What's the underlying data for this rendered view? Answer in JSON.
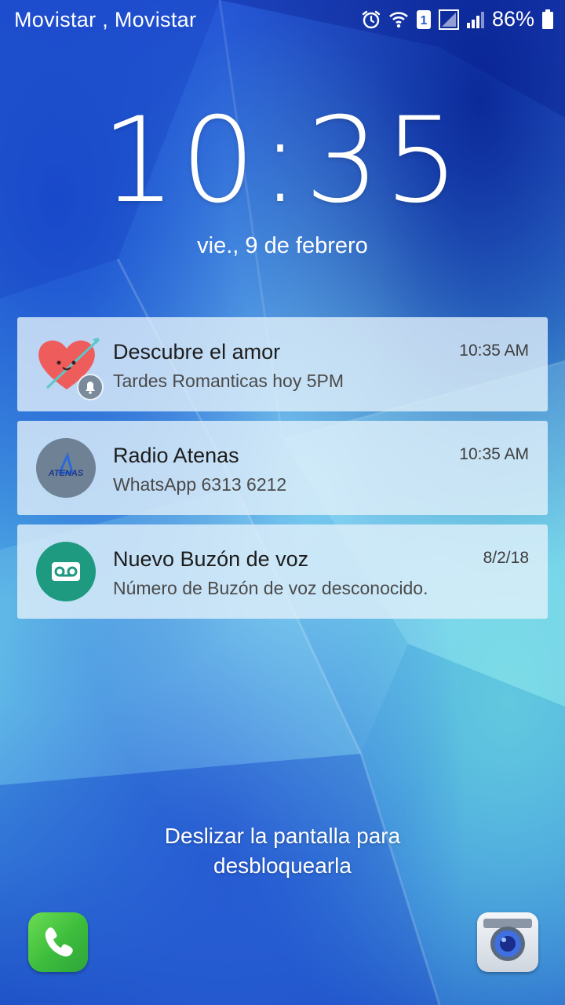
{
  "status_bar": {
    "carrier": "Movistar , Movistar",
    "sim_slot": "1",
    "battery_percent": "86%",
    "icons": [
      "alarm-icon",
      "wifi-icon",
      "sim-slot-icon",
      "signal-sim1-icon",
      "signal-sim2-icon",
      "battery-icon"
    ]
  },
  "lockscreen": {
    "time": "10:35",
    "date": "vie., 9 de febrero",
    "unlock_hint_line1": "Deslizar la pantalla para",
    "unlock_hint_line2": "desbloquearla"
  },
  "notifications": [
    {
      "title": "Descubre el amor",
      "subtitle": "Tardes Romanticas hoy 5PM",
      "time": "10:35 AM",
      "icon": "heart-arrow-icon"
    },
    {
      "title": "Radio Atenas",
      "subtitle": "WhatsApp 6313 6212",
      "time": "10:35 AM",
      "icon": "radio-atenas-logo",
      "logo_text": "ATENAS"
    },
    {
      "title": "Nuevo Buzón de voz",
      "subtitle": "Número de Buzón de voz desconocido.",
      "time": "8/2/18",
      "icon": "voicemail-icon"
    }
  ],
  "shortcuts": {
    "left": "phone-icon",
    "right": "camera-icon"
  },
  "colors": {
    "voicemail_avatar": "#1e9a80",
    "atenas_avatar": "#6f8194",
    "heart": "#ee5c5c",
    "phone_green": "#3cbc3c"
  }
}
